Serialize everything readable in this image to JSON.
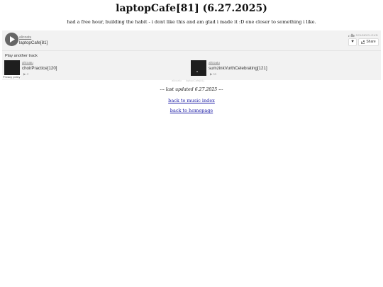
{
  "page": {
    "title": "laptopCafe[81] (6.27.2025)",
    "description": "had a free hour, building the habit - i dont like this and am glad i made it :D one closer to something i like."
  },
  "player": {
    "artist": "alicoatu",
    "track": "laptopCafe[81]",
    "brand": "SOUNDCLOUD",
    "like_icon": "♥",
    "share_label": "Share",
    "another_label": "Play another track",
    "privacy_label": "Privacy policy",
    "recommendations": [
      {
        "artist": "alicoatu",
        "title": "choirPractice[120]",
        "plays": "▶ 4"
      },
      {
        "artist": "alicoatu",
        "title": "sumzinkVurthCelebrating[121]",
        "plays": "▶ 11"
      }
    ],
    "ghost_text": [
      "alicoatu",
      "laptopCafe[81]"
    ],
    "colors": {
      "background": "#f2f2f2",
      "play_button": "#666666",
      "artwork": "#1e1e1e"
    }
  },
  "footer": {
    "last_updated": "--- last updated 6.27.2025 ---",
    "music_index_link": "back to music index",
    "homepage_link": "back to homepage"
  }
}
